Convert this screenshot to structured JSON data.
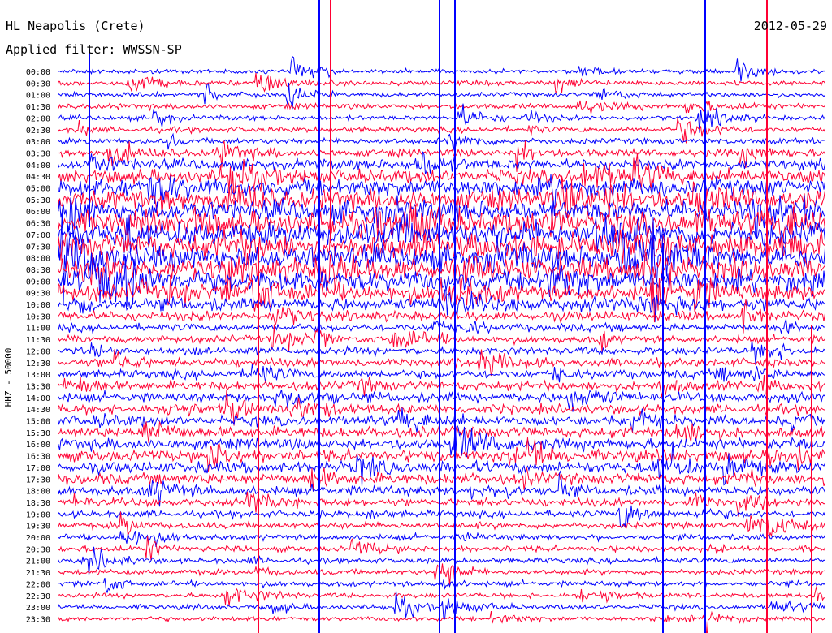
{
  "header": {
    "station": "HL Neapolis (Crete)",
    "date": "2012-05-29",
    "filter": "Applied filter: WWSSN-SP"
  },
  "side_label": "HHZ - 50000",
  "chart_data": {
    "type": "seismogram",
    "title": "HL Neapolis (Crete)",
    "date": "2012-05-29",
    "channel": "HHZ",
    "scale": "50000",
    "filter": "WWSSN-SP",
    "row_interval_minutes": 30,
    "row_labels": [
      "00:00",
      "00:30",
      "01:00",
      "01:30",
      "02:00",
      "02:30",
      "03:00",
      "03:30",
      "04:00",
      "04:30",
      "05:00",
      "05:30",
      "06:00",
      "06:30",
      "07:00",
      "07:30",
      "08:00",
      "08:30",
      "09:00",
      "09:30",
      "10:00",
      "10:30",
      "11:00",
      "11:30",
      "12:00",
      "12:30",
      "13:00",
      "13:30",
      "14:00",
      "14:30",
      "15:00",
      "15:30",
      "16:00",
      "16:30",
      "17:00",
      "17:30",
      "18:00",
      "18:30",
      "19:00",
      "19:30",
      "20:00",
      "20:30",
      "21:00",
      "21:30",
      "22:00",
      "22:30",
      "23:00",
      "23:30"
    ],
    "series_colors": [
      "#0000ff",
      "#ff0033"
    ],
    "activity_profile": [
      0.5,
      0.6,
      0.5,
      0.7,
      0.6,
      0.7,
      0.8,
      1.2,
      1.8,
      2.5,
      3.2,
      3.8,
      4.2,
      4.5,
      4.8,
      5.0,
      5.0,
      4.6,
      4.0,
      3.2,
      2.4,
      1.6,
      1.2,
      1.1,
      1.2,
      1.3,
      1.4,
      1.5,
      1.6,
      1.6,
      1.7,
      1.8,
      1.9,
      2.0,
      2.0,
      1.9,
      1.6,
      1.2,
      1.0,
      0.9,
      0.8,
      0.8,
      0.7,
      0.7,
      0.7,
      0.6,
      0.6,
      0.5
    ]
  }
}
